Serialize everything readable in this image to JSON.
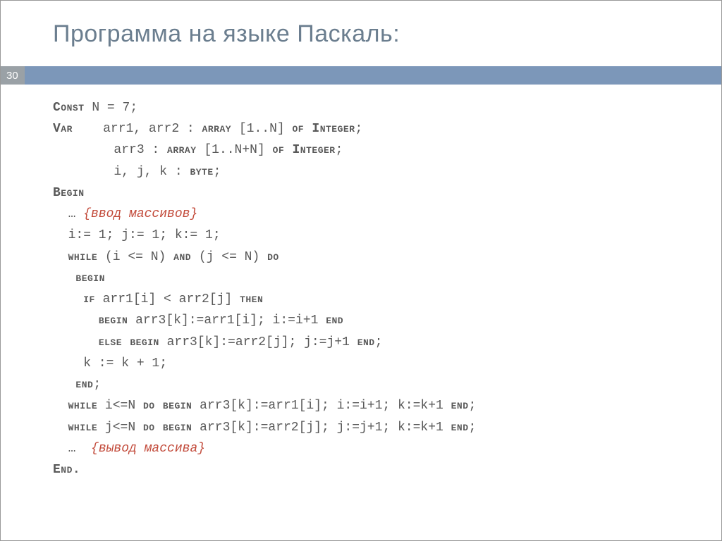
{
  "title": "Программа на языке Паскаль:",
  "page_number": "30",
  "code": {
    "l01a": "Const",
    "l01b": " N = 7;",
    "l02a": "Var",
    "l02b": "    arr1, arr2 : ",
    "l02c": "array",
    "l02d": " [1..N] ",
    "l02e": "of Integer",
    "l02f": ";",
    "l03a": "        arr3 : ",
    "l03b": "array",
    "l03c": " [1..N+N] ",
    "l03d": "of Integer",
    "l03e": ";",
    "l04": "        i, j, k : ",
    "l04b": "byte",
    "l04c": ";",
    "l05": "Begin",
    "l06i": "  … ",
    "l06c": "{ввод массивов}",
    "l07": "  i:= 1; j:= 1; k:= 1;",
    "l08a": "  ",
    "l08b": "while",
    "l08c": " (i <= N) ",
    "l08d": "and",
    "l08e": " (j <= N) ",
    "l08f": "do",
    "l09a": "   ",
    "l09b": "begin",
    "l10a": "    ",
    "l10b": "if",
    "l10c": " arr1[i] < arr2[j] ",
    "l10d": "then",
    "l11a": "      ",
    "l11b": "begin",
    "l11c": " arr3[k]:=arr1[i]; i:=i+1 ",
    "l11d": "end",
    "l12a": "      ",
    "l12b": "else begin",
    "l12c": " arr3[k]:=arr2[j]; j:=j+1 ",
    "l12d": "end",
    "l12e": ";",
    "l13": "    k := k + 1;",
    "l14a": "   ",
    "l14b": "end",
    "l14c": ";",
    "l15a": "  ",
    "l15b": "while",
    "l15c": " i<=N ",
    "l15d": "do begin",
    "l15e": " arr3[k]:=arr1[i]; i:=i+1; k:=k+1 ",
    "l15f": "end",
    "l15g": ";",
    "l16a": "  ",
    "l16b": "while",
    "l16c": " j<=N ",
    "l16d": "do begin",
    "l16e": " arr3[k]:=arr2[j]; j:=j+1; k:=k+1 ",
    "l16f": "end",
    "l16g": ";",
    "l17i": "  …  ",
    "l17c": "{вывод массива}",
    "l18": "End."
  }
}
